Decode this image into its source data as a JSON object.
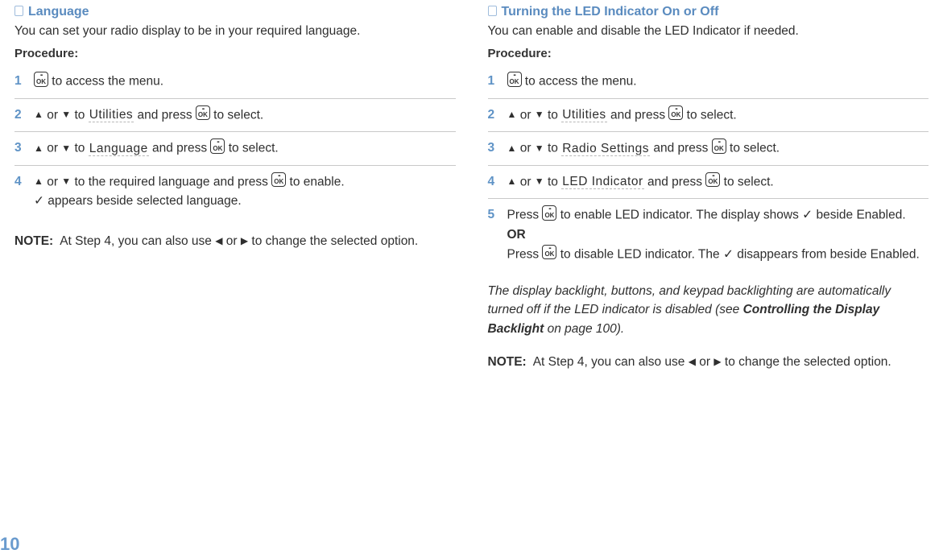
{
  "left": {
    "title": "Language",
    "lead": "You can set your radio display to be in your required language.",
    "procedureLabel": "Procedure:",
    "steps": {
      "s1": {
        "num": "1",
        "a": " to access the menu."
      },
      "s2": {
        "num": "2",
        "a": " or ",
        "b": " to ",
        "menu": "Utilities",
        "c": " and press ",
        "d": " to select."
      },
      "s3": {
        "num": "3",
        "a": " or ",
        "b": " to ",
        "menu": "Language",
        "c": " and press ",
        "d": " to select."
      },
      "s4": {
        "num": "4",
        "a": " or ",
        "b": " to the required language and press ",
        "c": " to enable.",
        "d": "✓ appears beside selected language."
      }
    },
    "noteLabel": "NOTE:",
    "noteA": "At Step 4, you can also use ",
    "noteB": " or ",
    "noteC": " to change the selected option."
  },
  "right": {
    "title": "Turning the LED Indicator On or Off",
    "lead": "You can enable and disable the LED Indicator if needed.",
    "procedureLabel": "Procedure:",
    "steps": {
      "s1": {
        "num": "1",
        "a": " to access the menu."
      },
      "s2": {
        "num": "2",
        "a": " or ",
        "b": " to ",
        "menu": "Utilities",
        "c": " and press ",
        "d": " to select."
      },
      "s3": {
        "num": "3",
        "a": " or ",
        "b": " to ",
        "menu": "Radio Settings",
        "c": " and press ",
        "d": " to select."
      },
      "s4": {
        "num": "4",
        "a": " or ",
        "b": " to ",
        "menu": "LED Indicator",
        "c": " and press ",
        "d": " to select."
      },
      "s5": {
        "num": "5",
        "a": "Press ",
        "b": " to enable LED indicator. The display shows ✓ beside Enabled.",
        "or": "OR",
        "c": "Press ",
        "d": " to disable LED indicator. The ✓ disappears from beside Enabled."
      }
    },
    "italicA": "The display backlight, buttons, and keypad backlighting are automatically turned off if the LED indicator is disabled (see ",
    "italicBold": "Controlling the Display Backlight",
    "italicB": " on page 100).",
    "noteLabel": "NOTE:",
    "noteA": "At Step 4, you can also use ",
    "noteB": " or ",
    "noteC": " to change the selected option."
  },
  "pageNumber": "10",
  "icons": {
    "up": "▲",
    "down": "▼",
    "left": "◀",
    "right": "▶"
  }
}
